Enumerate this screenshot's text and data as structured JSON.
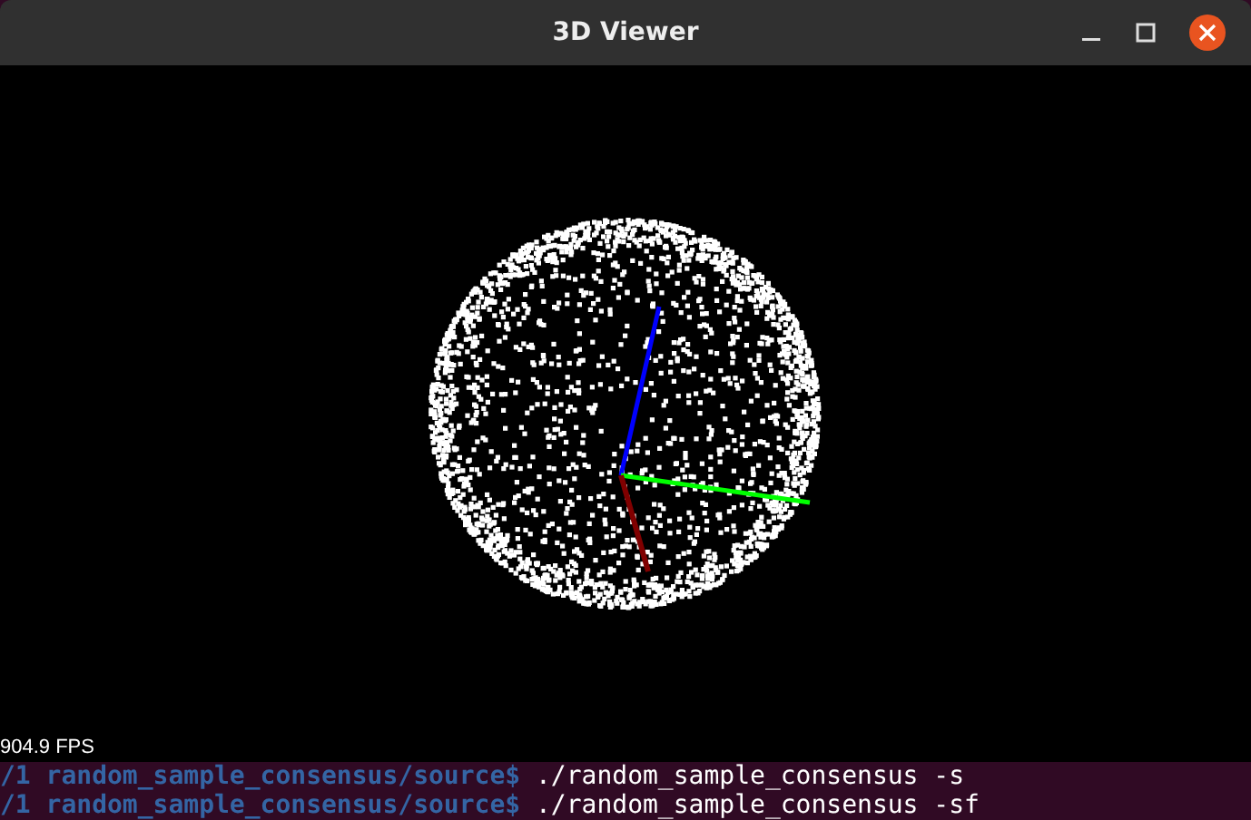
{
  "window": {
    "title": "3D Viewer"
  },
  "viewer": {
    "fps": "904.9 FPS"
  },
  "terminal": {
    "lines": [
      {
        "prompt": "/1 random_sample_consensus/source$",
        "command": "./random_sample_consensus -s"
      },
      {
        "prompt": "/1 random_sample_consensus/source$",
        "command": "./random_sample_consensus -sf"
      }
    ]
  }
}
